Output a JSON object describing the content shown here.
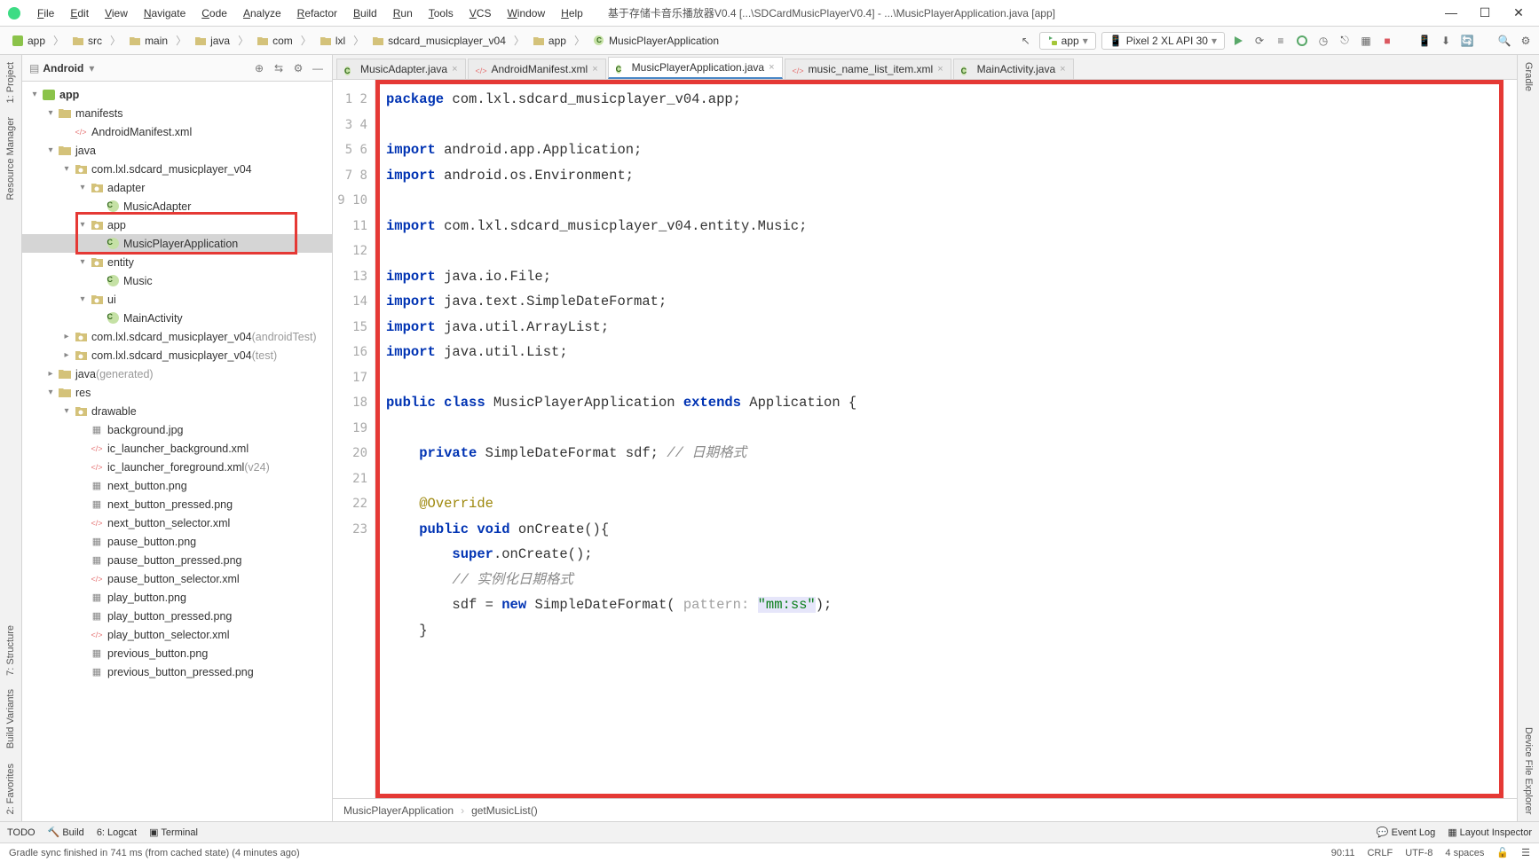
{
  "menubar": [
    "File",
    "Edit",
    "View",
    "Navigate",
    "Code",
    "Analyze",
    "Refactor",
    "Build",
    "Run",
    "Tools",
    "VCS",
    "Window",
    "Help"
  ],
  "title_text": "基于存储卡音乐播放器V0.4 [...\\SDCardMusicPlayerV0.4] - ...\\MusicPlayerApplication.java [app]",
  "breadcrumb": [
    "app",
    "src",
    "main",
    "java",
    "com",
    "lxl",
    "sdcard_musicplayer_v04",
    "app",
    "MusicPlayerApplication"
  ],
  "config_app": "app",
  "config_device": "Pixel 2 XL API 30",
  "panel": {
    "title": "Android"
  },
  "tree": [
    {
      "d": 0,
      "tw": "▾",
      "ico": "mod",
      "label": "app",
      "bold": true
    },
    {
      "d": 1,
      "tw": "▾",
      "ico": "folder",
      "label": "manifests"
    },
    {
      "d": 2,
      "tw": "",
      "ico": "xml",
      "label": "AndroidManifest.xml"
    },
    {
      "d": 1,
      "tw": "▾",
      "ico": "folder",
      "label": "java"
    },
    {
      "d": 2,
      "tw": "▾",
      "ico": "pkg",
      "label": "com.lxl.sdcard_musicplayer_v04"
    },
    {
      "d": 3,
      "tw": "▾",
      "ico": "pkg",
      "label": "adapter"
    },
    {
      "d": 4,
      "tw": "",
      "ico": "c",
      "label": "MusicAdapter"
    },
    {
      "d": 3,
      "tw": "▾",
      "ico": "pkg",
      "label": "app",
      "hlStart": true
    },
    {
      "d": 4,
      "tw": "",
      "ico": "c",
      "label": "MusicPlayerApplication",
      "selected": true,
      "hlEnd": true
    },
    {
      "d": 3,
      "tw": "▾",
      "ico": "pkg",
      "label": "entity"
    },
    {
      "d": 4,
      "tw": "",
      "ico": "c",
      "label": "Music"
    },
    {
      "d": 3,
      "tw": "▾",
      "ico": "pkg",
      "label": "ui"
    },
    {
      "d": 4,
      "tw": "",
      "ico": "c",
      "label": "MainActivity"
    },
    {
      "d": 2,
      "tw": "▸",
      "ico": "pkg",
      "label": "com.lxl.sdcard_musicplayer_v04",
      "suffix": "(androidTest)"
    },
    {
      "d": 2,
      "tw": "▸",
      "ico": "pkg",
      "label": "com.lxl.sdcard_musicplayer_v04",
      "suffix": "(test)"
    },
    {
      "d": 1,
      "tw": "▸",
      "ico": "folder",
      "label": "java",
      "suffix": "(generated)"
    },
    {
      "d": 1,
      "tw": "▾",
      "ico": "folder",
      "label": "res"
    },
    {
      "d": 2,
      "tw": "▾",
      "ico": "pkg",
      "label": "drawable"
    },
    {
      "d": 3,
      "tw": "",
      "ico": "img",
      "label": "background.jpg"
    },
    {
      "d": 3,
      "tw": "",
      "ico": "xml",
      "label": "ic_launcher_background.xml"
    },
    {
      "d": 3,
      "tw": "",
      "ico": "xml",
      "label": "ic_launcher_foreground.xml",
      "suffix": "(v24)"
    },
    {
      "d": 3,
      "tw": "",
      "ico": "img",
      "label": "next_button.png"
    },
    {
      "d": 3,
      "tw": "",
      "ico": "img",
      "label": "next_button_pressed.png"
    },
    {
      "d": 3,
      "tw": "",
      "ico": "xml",
      "label": "next_button_selector.xml"
    },
    {
      "d": 3,
      "tw": "",
      "ico": "img",
      "label": "pause_button.png"
    },
    {
      "d": 3,
      "tw": "",
      "ico": "img",
      "label": "pause_button_pressed.png"
    },
    {
      "d": 3,
      "tw": "",
      "ico": "xml",
      "label": "pause_button_selector.xml"
    },
    {
      "d": 3,
      "tw": "",
      "ico": "img",
      "label": "play_button.png"
    },
    {
      "d": 3,
      "tw": "",
      "ico": "img",
      "label": "play_button_pressed.png"
    },
    {
      "d": 3,
      "tw": "",
      "ico": "xml",
      "label": "play_button_selector.xml"
    },
    {
      "d": 3,
      "tw": "",
      "ico": "img",
      "label": "previous_button.png"
    },
    {
      "d": 3,
      "tw": "",
      "ico": "img",
      "label": "previous_button_pressed.png"
    }
  ],
  "tabs": [
    {
      "label": "MusicAdapter.java",
      "ico": "c"
    },
    {
      "label": "AndroidManifest.xml",
      "ico": "xml"
    },
    {
      "label": "MusicPlayerApplication.java",
      "ico": "c",
      "active": true
    },
    {
      "label": "music_name_list_item.xml",
      "ico": "xml"
    },
    {
      "label": "MainActivity.java",
      "ico": "c"
    }
  ],
  "lines": 23,
  "breadcrumb_bottom": [
    "MusicPlayerApplication",
    "getMusicList()"
  ],
  "bottom_tools_left": [
    "TODO",
    "Build",
    "6: Logcat",
    "Terminal"
  ],
  "bottom_tools_right": [
    "Event Log",
    "Layout Inspector"
  ],
  "status_msg": "Gradle sync finished in 741 ms (from cached state) (4 minutes ago)",
  "status_right": [
    "90:11",
    "CRLF",
    "UTF-8",
    "4 spaces"
  ],
  "left_gutter": [
    "1: Project",
    "Resource Manager"
  ],
  "left_gutter2": [
    "7: Structure",
    "Build Variants",
    "2: Favorites"
  ],
  "right_gutter": [
    "Gradle",
    "Device File Explorer"
  ]
}
